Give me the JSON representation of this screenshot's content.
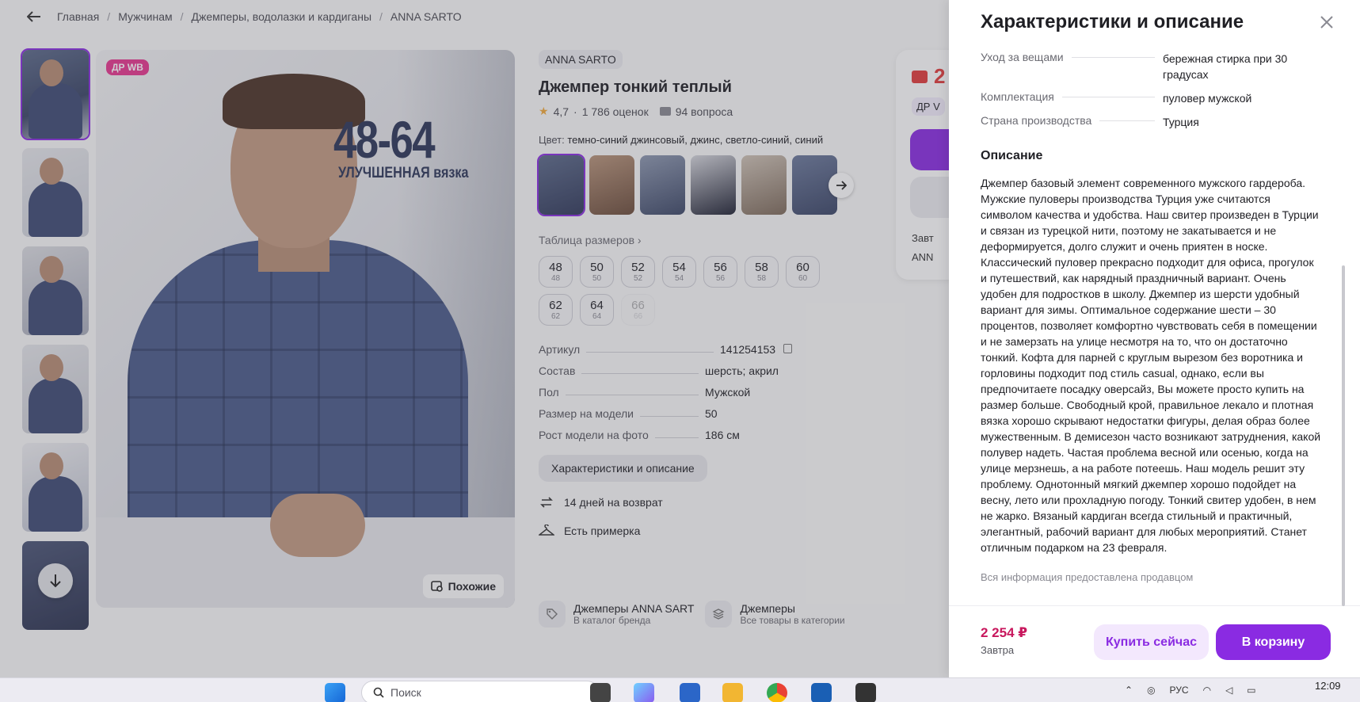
{
  "breadcrumb": {
    "items": [
      "Главная",
      "Мужчинам",
      "Джемперы, водолазки и кардиганы",
      "ANNA SARTO"
    ]
  },
  "gallery": {
    "badge": "ДР WB",
    "overlay_size": "48-64",
    "overlay_sub": "УЛУЧШЕННАЯ вязка",
    "similar_label": "Похожие"
  },
  "product": {
    "brand": "ANNA SARTO",
    "title": "Джемпер тонкий теплый",
    "rating": "4,7",
    "reviews": "1 786 оценок",
    "questions": "94 вопроса",
    "color_label": "Цвет:",
    "color_values": "темно-синий джинсовый, джинс, светло-синий, синий",
    "size_table_label": "Таблица размеров",
    "sizes": [
      {
        "n": "48",
        "r": "48",
        "disabled": false
      },
      {
        "n": "50",
        "r": "50",
        "disabled": false
      },
      {
        "n": "52",
        "r": "52",
        "disabled": false
      },
      {
        "n": "54",
        "r": "54",
        "disabled": false
      },
      {
        "n": "56",
        "r": "56",
        "disabled": false
      },
      {
        "n": "58",
        "r": "58",
        "disabled": false
      },
      {
        "n": "60",
        "r": "60",
        "disabled": false
      },
      {
        "n": "62",
        "r": "62",
        "disabled": false
      },
      {
        "n": "64",
        "r": "64",
        "disabled": false
      },
      {
        "n": "66",
        "r": "66",
        "disabled": true
      }
    ],
    "specs": [
      {
        "k": "Артикул",
        "v": "141254153"
      },
      {
        "k": "Состав",
        "v": "шерсть; акрил"
      },
      {
        "k": "Пол",
        "v": "Мужской"
      },
      {
        "k": "Размер на модели",
        "v": "50"
      },
      {
        "k": "Рост модели на фото",
        "v": "186 см"
      }
    ],
    "char_button": "Характеристики и описание",
    "perks": [
      "14 дней на возврат",
      "Есть примерка"
    ],
    "catalog": [
      {
        "title": "Джемперы ANNA SART",
        "sub": "В каталог бренда"
      },
      {
        "title": "Джемперы",
        "sub": "Все товары в категории"
      }
    ]
  },
  "buybox": {
    "price_partial": "2",
    "dr_partial": "ДР V",
    "line1": "Завт",
    "line2": "ANN"
  },
  "drawer": {
    "title": "Характеристики и описание",
    "specs": [
      {
        "k": "Уход за вещами",
        "v": "бережная стирка при 30 градусах"
      },
      {
        "k": "Комплектация",
        "v": "пуловер мужской"
      },
      {
        "k": "Страна производства",
        "v": "Турция"
      }
    ],
    "desc_heading": "Описание",
    "description": "Джемпер базовый элемент современного мужского гардероба. Мужские пуловеры производства Турция уже считаются символом качества и удобства. Наш свитер произведен в Турции и связан из турецкой нити, поэтому не закатывается и не деформируется, долго служит и очень приятен в носке. Классический пуловер прекрасно подходит для офиса, прогулок и путешествий, как нарядный праздничный вариант. Очень удобен для подростков в школу. Джемпер из шерсти удобный вариант для зимы. Оптимальное содержание шести – 30 процентов, позволяет комфортно чувствовать себя в помещении и не замерзать на улице несмотря на то, что он достаточно тонкий. Кофта для парней с круглым вырезом без воротника и горловины подходит под стиль casual, однако, если вы предпочитаете посадку оверсайз, Вы можете просто купить на размер больше. Свободный крой, правильное лекало и плотная вязка хорошо скрывают недостатки фигуры, делая образ более мужественным. В демисезон часто возникают затруднения, какой полувер надеть. Частая проблема весной или осенью, когда на улице мерзнешь, а на работе потеешь. Наш модель решит эту проблему. Однотонный мягкий джемпер хорошо подойдет на весну, лето или прохладную погоду. Тонкий свитер удобен, в нем не жарко. Вязаный кардиган всегда стильный и практичный, элегантный, рабочий вариант для любых мероприятий. Станет отличным подарком на 23 февраля.",
    "note": "Вся информация предоставлена продавцом",
    "footer": {
      "price": "2 254 ₽",
      "date": "Завтра",
      "buy_now": "Купить сейчас",
      "to_cart": "В корзину"
    }
  },
  "taskbar": {
    "search_placeholder": "Поиск",
    "lang": "РУС",
    "time": "12:09"
  },
  "colors": {
    "accent": "#8a2be2",
    "price": "#c8175d",
    "badge": "#e8368f"
  }
}
